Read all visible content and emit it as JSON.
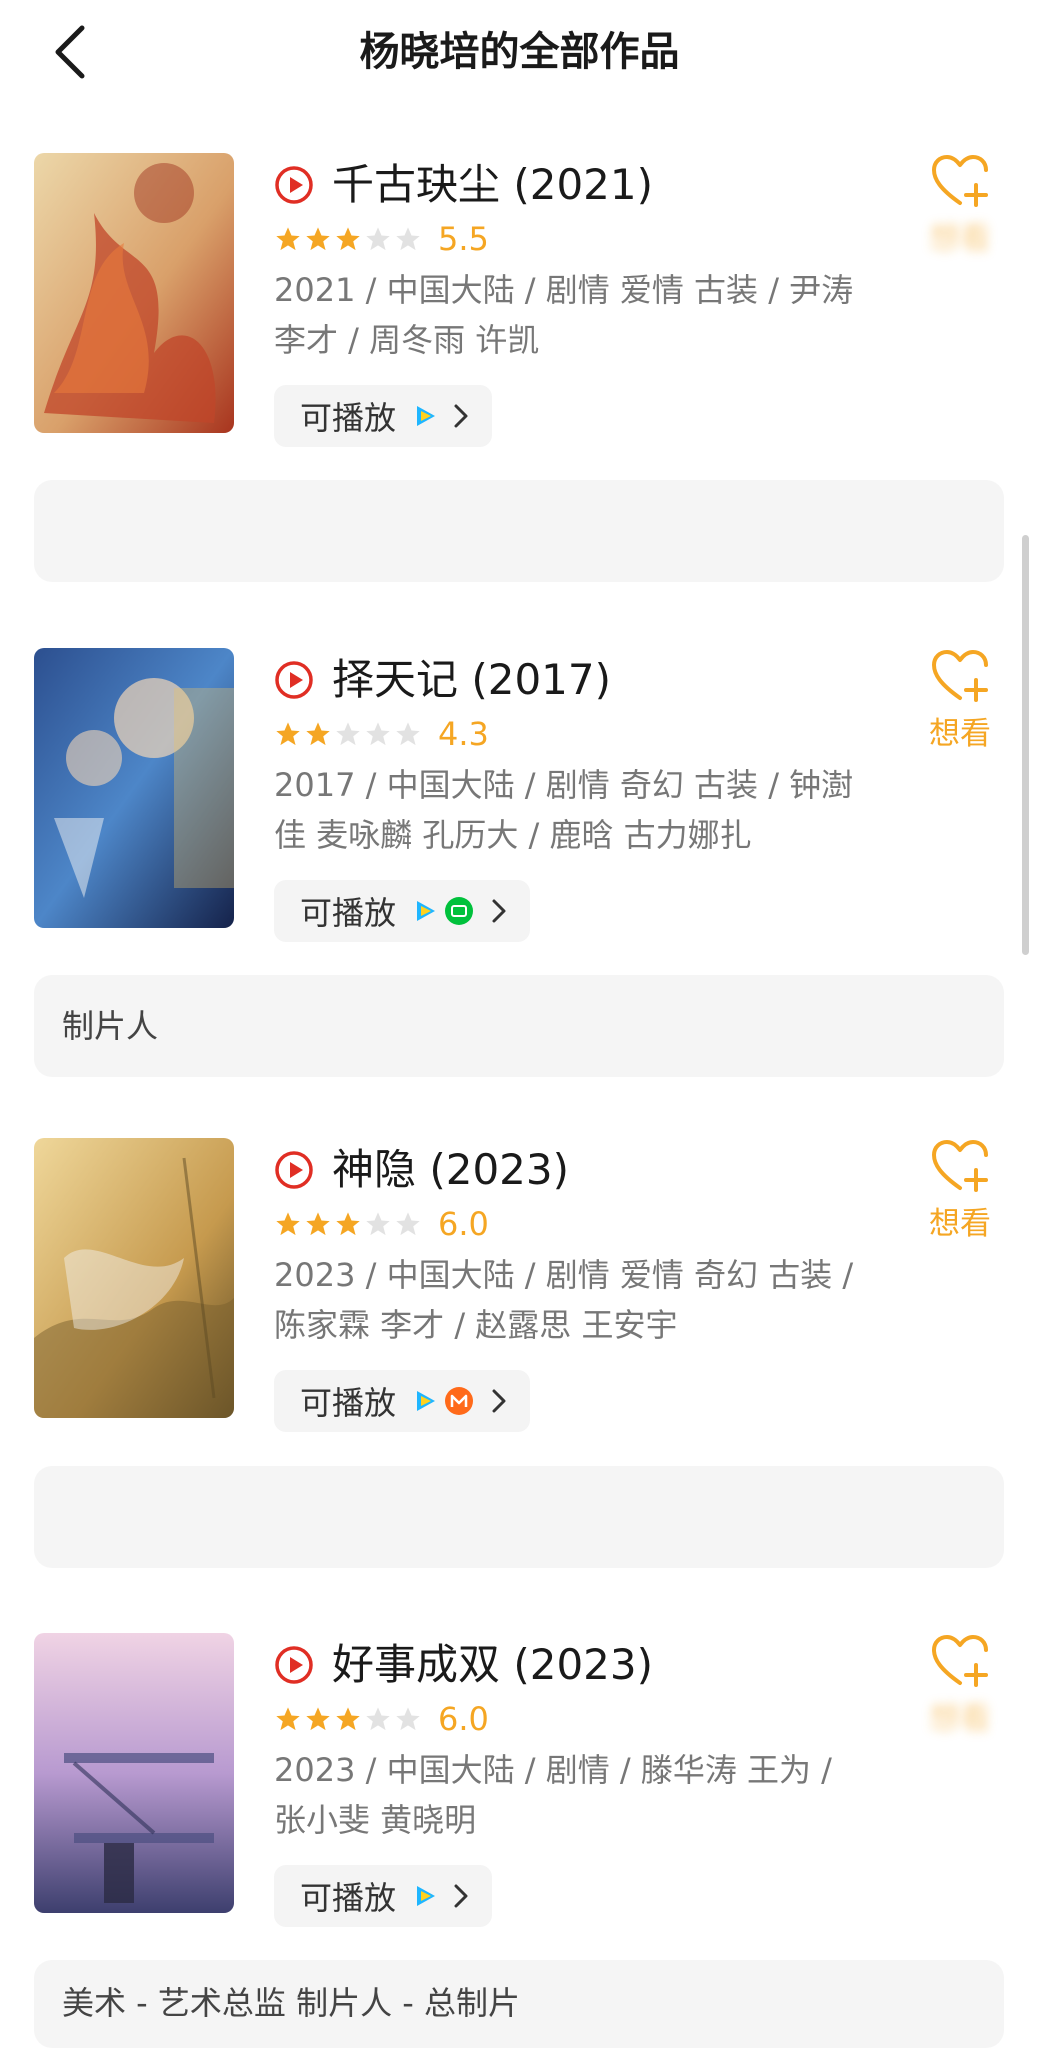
{
  "header": {
    "title": "杨晓培的全部作品"
  },
  "movies": [
    {
      "title": "千古玦尘 (2021)",
      "stars": 3,
      "rating": "5.5",
      "info": "2021 / 中国大陆 / 剧情 爱情 古装 / 尹涛 李才 / 周冬雨 许凯",
      "play_label": "可播放",
      "want_label": "想看",
      "role": "",
      "poster_colors": [
        "#e9cf9f",
        "#c9502e",
        "#8a2a1a"
      ]
    },
    {
      "title": "择天记 (2017)",
      "stars": 2,
      "rating": "4.3",
      "info": "2017 / 中国大陆 / 剧情 奇幻 古装 / 钟澍佳 麦咏麟 孔历大 / 鹿晗 古力娜扎",
      "play_label": "可播放",
      "want_label": "想看",
      "role": "制片人",
      "poster_colors": [
        "#1d3a73",
        "#6b9fd6",
        "#e8c36a"
      ]
    },
    {
      "title": "神隐 (2023)",
      "stars": 3,
      "rating": "6.0",
      "info": "2023 / 中国大陆 / 剧情 爱情 奇幻 古装 / 陈家霖 李才 / 赵露思 王安宇",
      "play_label": "可播放",
      "want_label": "想看",
      "role": "",
      "poster_colors": [
        "#e6c77f",
        "#b6862f",
        "#6f5a2a"
      ]
    },
    {
      "title": "好事成双 (2023)",
      "stars": 3,
      "rating": "6.0",
      "info": "2023 / 中国大陆 / 剧情 / 滕华涛 王为 / 张小斐 黄晓明",
      "play_label": "可播放",
      "want_label": "想看",
      "role": "美术 - 艺术总监 制片人 - 总制片",
      "poster_colors": [
        "#d5a6c9",
        "#6d6fa8",
        "#3a3f6b"
      ]
    }
  ],
  "colors": {
    "accent": "#f5a623",
    "play_red": "#e02e24",
    "iqiyi_green": "#00c13c",
    "mgtv_orange": "#ff6a1a"
  }
}
